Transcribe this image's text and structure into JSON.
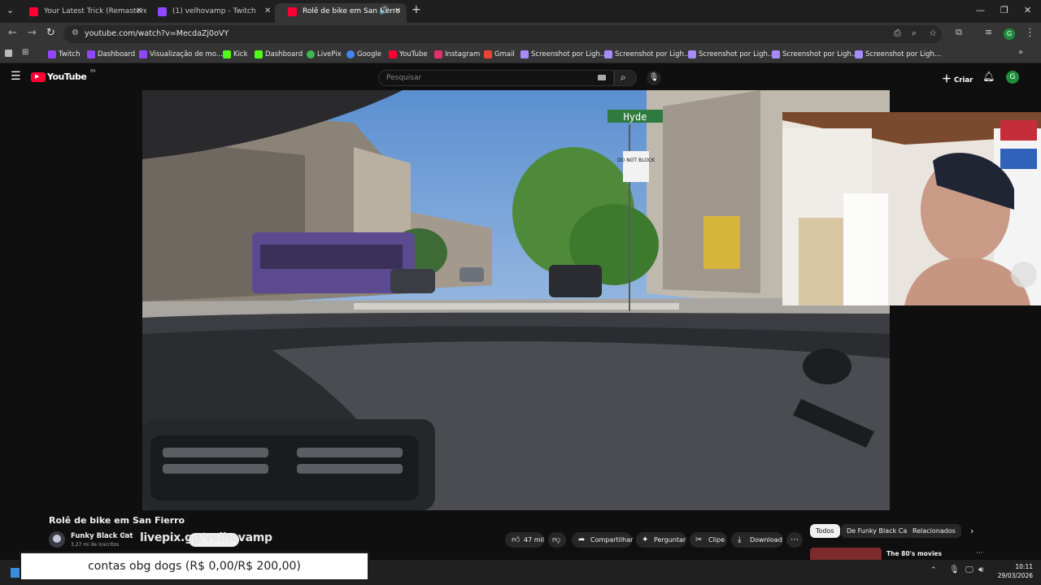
{
  "browser": {
    "tabs": [
      {
        "title": "Your Latest Trick (Remastered 1",
        "active": false,
        "favicon_color": "#ff0033"
      },
      {
        "title": "(1) velhovamp - Twitch",
        "active": false,
        "favicon_color": "#9146ff"
      },
      {
        "title": "Rolê de bike em San Fierro",
        "active": true,
        "favicon_color": "#ff0033"
      }
    ],
    "new_tab": "+",
    "url": "youtube.com/watch?v=MecdaZj0oVY",
    "bookmarks": [
      {
        "label": "Twitch",
        "icon_color": "#9146ff"
      },
      {
        "label": "Dashboard",
        "icon_color": "#9146ff"
      },
      {
        "label": "Visualização de mo...",
        "icon_color": "#9146ff"
      },
      {
        "label": "Kick",
        "icon_color": "#53fc18"
      },
      {
        "label": "Dashboard",
        "icon_color": "#53fc18"
      },
      {
        "label": "LivePix",
        "icon_color": "#3fb950"
      },
      {
        "label": "Google",
        "icon_color": "#4285f4"
      },
      {
        "label": "YouTube",
        "icon_color": "#ff0033"
      },
      {
        "label": "Instagram",
        "icon_color": "#e1306c"
      },
      {
        "label": "Gmail",
        "icon_color": "#ea4335"
      },
      {
        "label": "Screenshot por Ligh...",
        "icon_color": "#a78bfa"
      },
      {
        "label": "Screenshot por Ligh...",
        "icon_color": "#a78bfa"
      },
      {
        "label": "Screenshot por Ligh...",
        "icon_color": "#a78bfa"
      },
      {
        "label": "Screenshot por Ligh...",
        "icon_color": "#a78bfa"
      },
      {
        "label": "Screenshot por Ligh...",
        "icon_color": "#a78bfa"
      }
    ],
    "profile_initial": "G"
  },
  "youtube": {
    "logo_text": "YouTube",
    "logo_badge": "BR",
    "search_placeholder": "Pesquisar",
    "create_label": "Criar",
    "avatar_initial": "G",
    "street_sign": "Hyde",
    "sign_text": "DO NOT BLOCK",
    "video_title": "Rolê de bike em San Fierro",
    "channel": {
      "name": "Funky Black Cat",
      "subscribers": "3,27 mi de inscritos"
    },
    "actions": {
      "likes": "47 mil",
      "share": "Compartilhar",
      "ask": "Perguntar",
      "clip": "Clipe",
      "download": "Download"
    },
    "chips": [
      "Todos",
      "De Funky Black Cat",
      "Relacionados"
    ],
    "related_title": "The 80's movies"
  },
  "overlay": {
    "livepix": "livepix.gg/velhovamp",
    "donation": "contas obg dogs (R$ 0,00/R$ 200,00)"
  },
  "taskbar": {
    "time": "10:11",
    "date": "29/03/2026"
  },
  "colors": {
    "yt_red": "#ff0033",
    "accent_green": "#1e8e3e"
  }
}
